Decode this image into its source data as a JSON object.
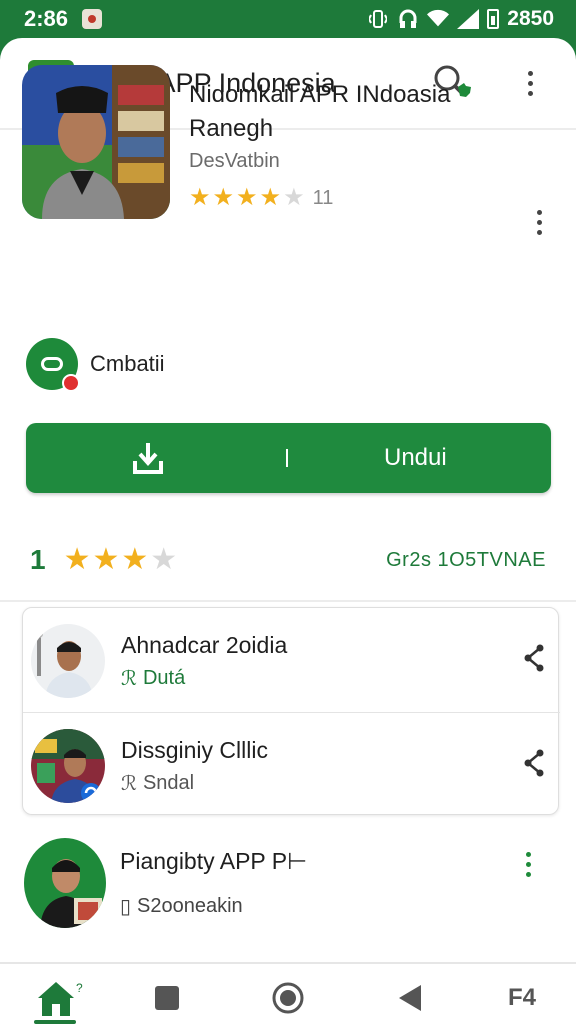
{
  "status_bar": {
    "time": "2:86",
    "right_text": "2850"
  },
  "app_bar": {
    "title": "APP APP Indonesia"
  },
  "detail": {
    "name": "Nidomkail APR INdoasia Ranegh",
    "developer": "DesVatbin",
    "rating_stars": 4,
    "rating_max": 5,
    "rating_count": "11",
    "badge_label": "Cmbatii",
    "download_label": "Undui"
  },
  "rating_summary": {
    "score": "1",
    "stars": 3,
    "stars_max": 4,
    "link_text": "Gr2s 1O5TVNAE"
  },
  "list": [
    {
      "title": "Ahnadcar 2oidia",
      "subtitle": "Dutá",
      "subtitle_prefix": "ℛ"
    },
    {
      "title": "Dissginiy Clllic",
      "subtitle": "Sndal",
      "subtitle_prefix": "ℛ"
    },
    {
      "title": "Piangibty APP P⊢",
      "subtitle": "S2ooneakin",
      "subtitle_prefix": "▯"
    }
  ],
  "nav": {
    "last_label": "F4"
  },
  "colors": {
    "primary_green": "#1e7a3a",
    "button_green": "#1f8a3e",
    "star_gold": "#f2b01e",
    "badge_red": "#e03030"
  },
  "icons": [
    "search-icon",
    "kebab-menu-icon",
    "download-icon",
    "share-icon",
    "home-icon",
    "square-icon",
    "circle-icon",
    "back-icon"
  ]
}
